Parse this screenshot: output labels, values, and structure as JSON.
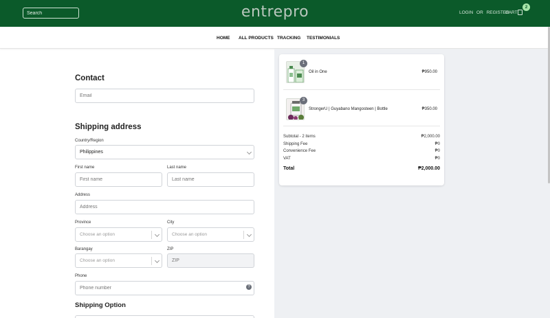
{
  "header": {
    "search_placeholder": "Search",
    "logo": "entrepro",
    "login": "LOGIN",
    "or": "OR",
    "register": "REGISTER",
    "cart_label": "CART",
    "cart_count": "2",
    "bg_color": "#0b5a2a"
  },
  "nav": {
    "items": [
      {
        "label": "HOME"
      },
      {
        "label": "ALL PRODUCTS"
      },
      {
        "label": "TRACKING"
      },
      {
        "label": "TESTIMONIALS"
      }
    ]
  },
  "contact": {
    "heading": "Contact",
    "email_placeholder": "Email"
  },
  "shipping": {
    "heading": "Shipping address",
    "country_label": "Country/Region",
    "country_value": "Philippines",
    "first_name_label": "First name",
    "first_name_placeholder": "First name",
    "last_name_label": "Last name",
    "last_name_placeholder": "Last name",
    "address_label": "Address",
    "address_placeholder": "Address",
    "province_label": "Province",
    "province_placeholder": "Choose an option",
    "city_label": "City",
    "city_placeholder": "Choose an option",
    "barangay_label": "Barangay",
    "barangay_placeholder": "Choose an option",
    "zip_label": "ZIP",
    "zip_placeholder": "ZIP",
    "phone_label": "Phone",
    "phone_placeholder": "Phone number",
    "help_glyph": "?"
  },
  "shipping_option": {
    "heading": "Shipping Option"
  },
  "summary": {
    "items": [
      {
        "name": "Oil in One",
        "qty": "1",
        "price": "₱950.00",
        "thumb_icon": "bottle-product-icon"
      },
      {
        "name": "StrongerU | Guyabano Mangosteen | Bottle",
        "qty": "3",
        "price": "₱350.00",
        "thumb_icon": "jar-product-icon"
      }
    ],
    "subtotal_label": "Subtotal - 2 items",
    "subtotal_value": "₱2,000.00",
    "shipping_fee_label": "Shipping Fee",
    "shipping_fee_value": "₱0",
    "convenience_fee_label": "Convenience Fee",
    "convenience_fee_value": "₱0",
    "vat_label": "VAT",
    "vat_value": "₱0",
    "total_label": "Total",
    "total_value": "₱2,000.00"
  }
}
